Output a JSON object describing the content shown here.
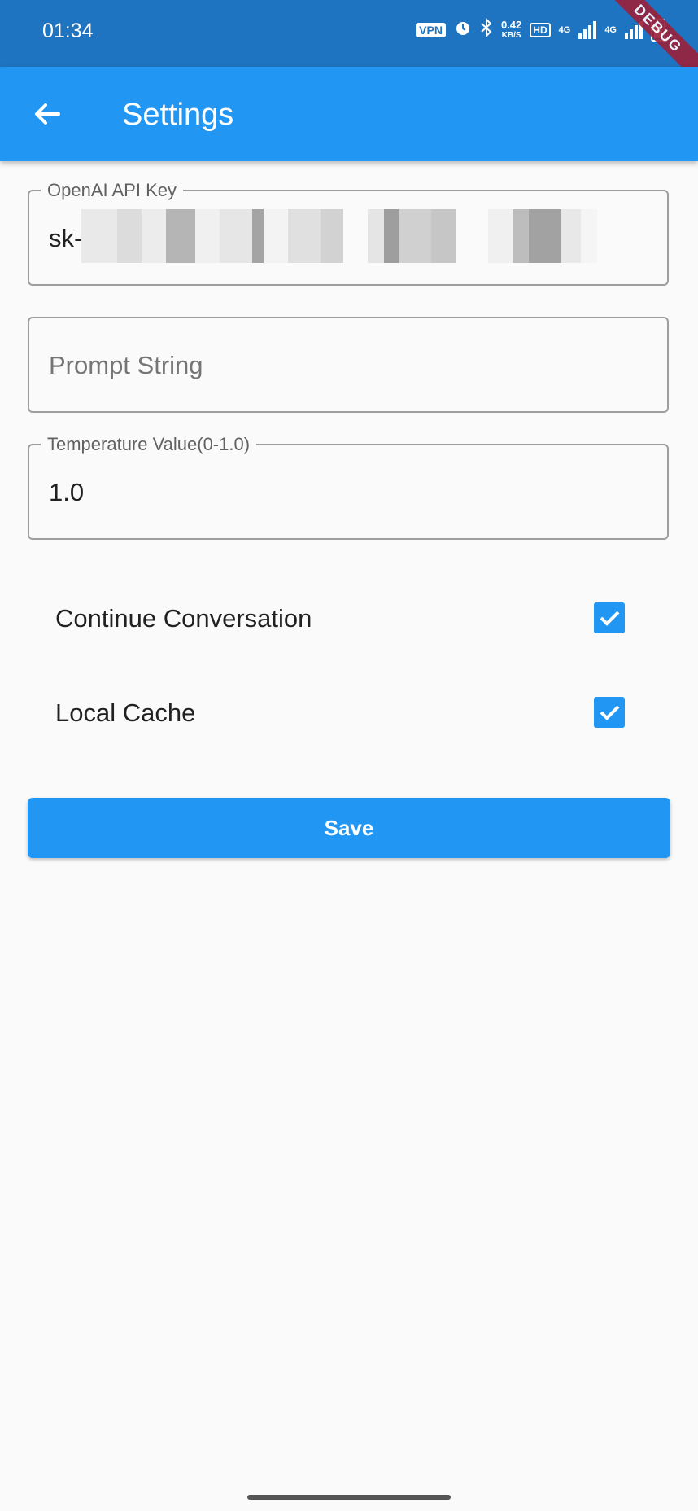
{
  "status_bar": {
    "time": "01:34",
    "vpn": "VPN",
    "speed_value": "0.42",
    "speed_unit": "KB/S",
    "hd": "HD",
    "network_1": "4G",
    "network_2": "4G",
    "debug_banner": "DEBUG"
  },
  "app_bar": {
    "title": "Settings",
    "back_icon": "arrow-back-icon"
  },
  "form": {
    "api_key": {
      "label": "OpenAI API Key",
      "value": "sk-"
    },
    "prompt": {
      "placeholder": "Prompt String",
      "value": ""
    },
    "temperature": {
      "label": "Temperature Value(0-1.0)",
      "value": "1.0"
    }
  },
  "options": [
    {
      "label": "Continue Conversation",
      "checked": true
    },
    {
      "label": "Local Cache",
      "checked": true
    }
  ],
  "save_label": "Save",
  "colors": {
    "primary": "#2196f3",
    "status_bar": "#1e74c0",
    "background": "#fafafa"
  }
}
